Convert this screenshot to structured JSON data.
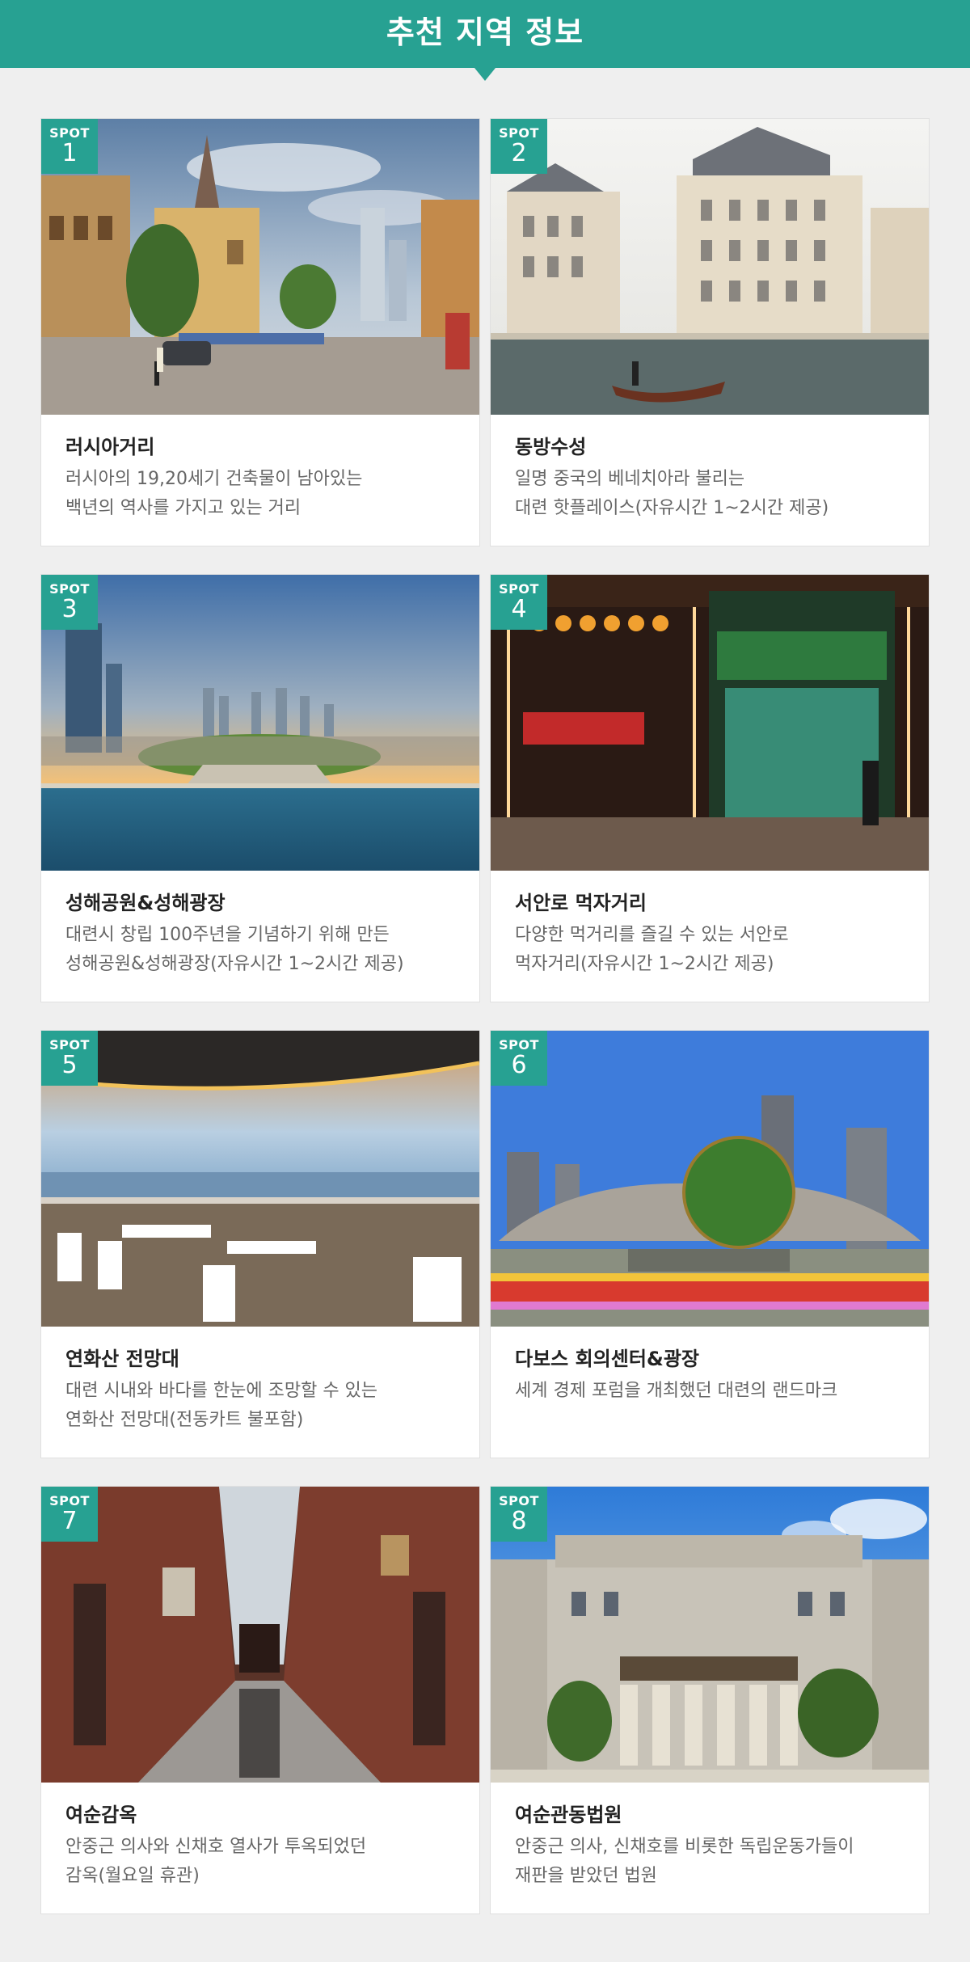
{
  "header": {
    "title": "추천 지역 정보"
  },
  "colors": {
    "accent": "#27a192",
    "background": "#efefef",
    "card": "#ffffff",
    "title_text": "#222222",
    "desc_text": "#666666"
  },
  "spots": [
    {
      "badge": "SPOT",
      "number": "1",
      "title": "러시아거리",
      "desc": "러시아의 19,20세기 건축물이 남아있는\n백년의 역사를 가지고 있는 거리",
      "image": "russian-street-photo"
    },
    {
      "badge": "SPOT",
      "number": "2",
      "title": "동방수성",
      "desc": "일명 중국의 베네치아라 불리는\n대련 핫플레이스(자유시간 1~2시간 제공)",
      "image": "venice-canal-photo"
    },
    {
      "badge": "SPOT",
      "number": "3",
      "title": "성해공원&성해광장",
      "desc": "대련시 창립 100주년을 기념하기 위해 만든\n성해공원&성해광장(자유시간 1~2시간 제공)",
      "image": "xinghai-square-photo"
    },
    {
      "badge": "SPOT",
      "number": "4",
      "title": "서안로 먹자거리",
      "desc": "다양한 먹거리를 즐길 수 있는 서안로\n먹자거리(자유시간 1~2시간 제공)",
      "image": "food-street-photo"
    },
    {
      "badge": "SPOT",
      "number": "5",
      "title": "연화산 전망대",
      "desc": "대련 시내와 바다를 한눈에 조망할 수 있는\n연화산 전망대(전동카트 불포함)",
      "image": "observatory-photo"
    },
    {
      "badge": "SPOT",
      "number": "6",
      "title": "다보스 회의센터&광장",
      "desc": "세계 경제 포럼을 개최했던 대련의 랜드마크",
      "image": "davos-center-photo"
    },
    {
      "badge": "SPOT",
      "number": "7",
      "title": "여순감옥",
      "desc": "안중근 의사와 신채호 열사가 투옥되었던\n감옥(월요일 휴관)",
      "image": "prison-corridor-photo"
    },
    {
      "badge": "SPOT",
      "number": "8",
      "title": "여순관동법원",
      "desc": "안중근 의사, 신채호를 비롯한 독립운동가들이\n재판을 받았던 법원",
      "image": "court-building-photo"
    }
  ]
}
